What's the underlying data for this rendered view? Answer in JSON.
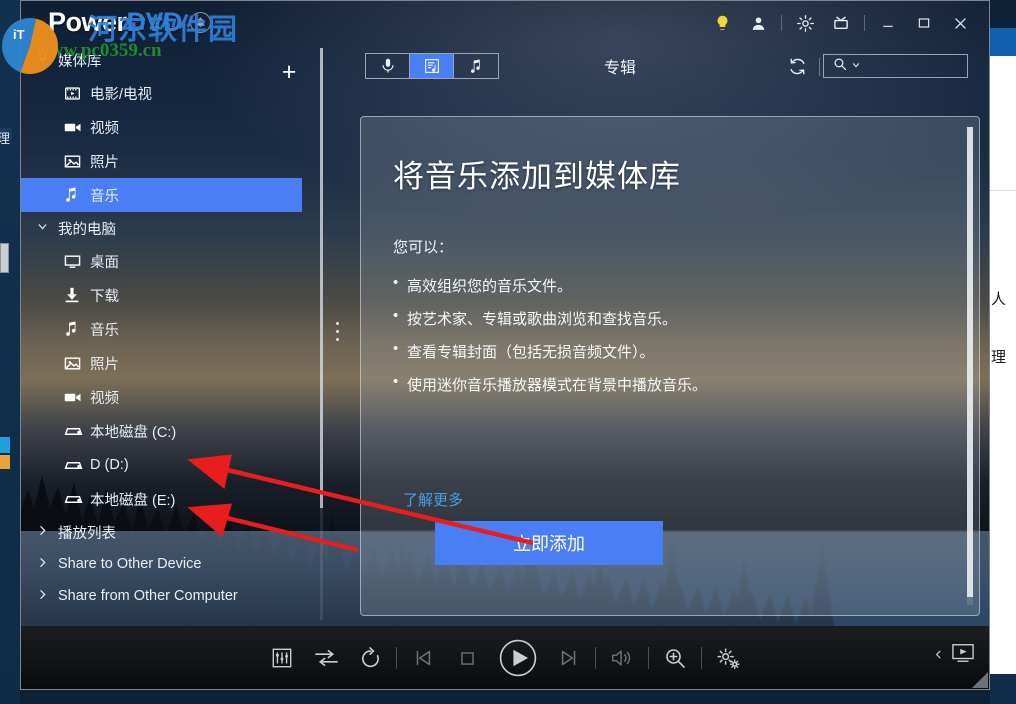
{
  "window": {
    "app_title": "PowerDVD",
    "app_title_prefix": "Power",
    "app_title_suffix": "DVD",
    "accent_color": "#4a7ef5",
    "link_color": "#4a9fe0"
  },
  "titlebar": {
    "bell_icon": "bell-icon",
    "buttons": [
      {
        "name": "lightbulb-icon",
        "label": "",
        "color": "#f5d33a"
      },
      {
        "name": "user-account-icon",
        "label": ""
      },
      {
        "name": "gear-settings-icon",
        "label": ""
      },
      {
        "name": "tv-mode-icon",
        "label": ""
      },
      {
        "name": "minimize-icon",
        "label": ""
      },
      {
        "name": "maximize-icon",
        "label": ""
      },
      {
        "name": "close-icon",
        "label": ""
      }
    ]
  },
  "sidebar": {
    "sections": [
      {
        "title": "媒体库",
        "expanded": true,
        "has_add_button": true,
        "add_label": "+",
        "items": [
          {
            "label": "电影/电视",
            "icon": "movie-tv-icon",
            "active": false
          },
          {
            "label": "视频",
            "icon": "video-camera-icon",
            "active": false
          },
          {
            "label": "照片",
            "icon": "photo-icon",
            "active": false
          },
          {
            "label": "音乐",
            "icon": "music-note-icon",
            "active": true
          }
        ]
      },
      {
        "title": "我的电脑",
        "expanded": true,
        "has_add_button": false,
        "items": [
          {
            "label": "桌面",
            "icon": "desktop-icon",
            "active": false
          },
          {
            "label": "下载",
            "icon": "download-icon",
            "active": false
          },
          {
            "label": "音乐",
            "icon": "music-note-icon",
            "active": false
          },
          {
            "label": "照片",
            "icon": "photo-icon",
            "active": false
          },
          {
            "label": "视频",
            "icon": "video-camera-icon",
            "active": false
          },
          {
            "label": "本地磁盘 (C:)",
            "icon": "hard-drive-icon",
            "active": false
          },
          {
            "label": "D (D:)",
            "icon": "hard-drive-icon",
            "active": false
          },
          {
            "label": "本地磁盘 (E:)",
            "icon": "hard-drive-icon",
            "active": false
          }
        ]
      }
    ],
    "collapsed_sections": [
      {
        "title": "播放列表",
        "expanded": false
      },
      {
        "title": "Share to Other Device",
        "expanded": false
      },
      {
        "title": "Share from Other Computer",
        "expanded": false
      }
    ]
  },
  "toolbar": {
    "segments": [
      {
        "name": "artist-view",
        "icon": "microphone-icon",
        "selected": false
      },
      {
        "name": "album-view",
        "icon": "album-list-icon",
        "selected": true
      },
      {
        "name": "song-view",
        "icon": "music-note-icon",
        "selected": false
      }
    ],
    "category_label": "专辑",
    "refresh_icon": "refresh-icon",
    "search": {
      "icon": "search-icon",
      "chevron": "chevron-down-icon",
      "value": "",
      "placeholder": ""
    }
  },
  "main": {
    "title": "将音乐添加到媒体库",
    "subtitle": "您可以：",
    "bullets": [
      "高效组织您的音乐文件。",
      "按艺术家、专辑或歌曲浏览和查找音乐。",
      "查看专辑封面（包括无损音频文件）。",
      "使用迷你音乐播放器模式在背景中播放音乐。"
    ],
    "learn_more": "了解更多",
    "primary_button": "立即添加"
  },
  "playback": {
    "controls": [
      {
        "name": "equalizer-button",
        "icon": "equalizer-icon",
        "dim": false
      },
      {
        "name": "shuffle-button",
        "icon": "shuffle-icon",
        "dim": false
      },
      {
        "name": "repeat-button",
        "icon": "repeat-icon",
        "dim": false
      },
      {
        "name": "previous-button",
        "icon": "previous-track-icon",
        "dim": true
      },
      {
        "name": "stop-button",
        "icon": "stop-icon",
        "dim": true
      },
      {
        "name": "play-button",
        "icon": "play-icon",
        "dim": false
      },
      {
        "name": "next-button",
        "icon": "next-track-icon",
        "dim": true
      },
      {
        "name": "volume-button",
        "icon": "speaker-volume-icon",
        "dim": true
      },
      {
        "name": "zoom-button",
        "icon": "magnifier-plus-icon",
        "dim": false
      },
      {
        "name": "settings-button",
        "icon": "gears-settings-icon",
        "dim": false
      }
    ],
    "collapse_icon": "chevron-left-icon",
    "screen_icon": "media-screen-icon"
  },
  "watermark": {
    "site_name": "河东软件园",
    "url": "www.pc0359.cn"
  },
  "annotations": {
    "arrow_color": "#e81d1d",
    "arrows": 2
  }
}
